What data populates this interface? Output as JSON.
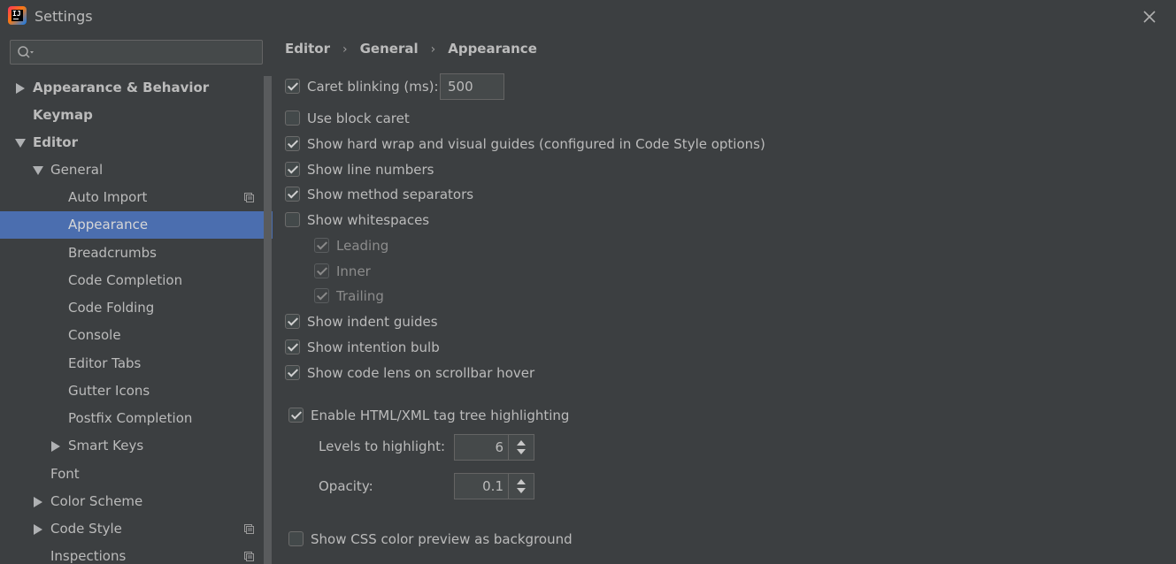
{
  "window": {
    "title": "Settings"
  },
  "search": {
    "placeholder": ""
  },
  "sidebar": {
    "items": [
      {
        "label": "Appearance & Behavior",
        "bold": true,
        "expand": "right"
      },
      {
        "label": "Keymap",
        "bold": true,
        "expand": "none"
      },
      {
        "label": "Editor",
        "bold": true,
        "expand": "down"
      },
      {
        "label": "General",
        "bold": false,
        "expand": "down"
      },
      {
        "label": "Auto Import",
        "bold": false,
        "expand": "none",
        "project_icon": true
      },
      {
        "label": "Appearance",
        "bold": false,
        "expand": "none",
        "selected": true
      },
      {
        "label": "Breadcrumbs",
        "bold": false,
        "expand": "none"
      },
      {
        "label": "Code Completion",
        "bold": false,
        "expand": "none"
      },
      {
        "label": "Code Folding",
        "bold": false,
        "expand": "none"
      },
      {
        "label": "Console",
        "bold": false,
        "expand": "none"
      },
      {
        "label": "Editor Tabs",
        "bold": false,
        "expand": "none"
      },
      {
        "label": "Gutter Icons",
        "bold": false,
        "expand": "none"
      },
      {
        "label": "Postfix Completion",
        "bold": false,
        "expand": "none"
      },
      {
        "label": "Smart Keys",
        "bold": false,
        "expand": "right"
      },
      {
        "label": "Font",
        "bold": false,
        "expand": "none"
      },
      {
        "label": "Color Scheme",
        "bold": false,
        "expand": "right"
      },
      {
        "label": "Code Style",
        "bold": false,
        "expand": "right",
        "project_icon": true
      },
      {
        "label": "Inspections",
        "bold": false,
        "expand": "none",
        "project_icon": true
      }
    ]
  },
  "breadcrumb": [
    "Editor",
    "General",
    "Appearance"
  ],
  "breadcrumb_separator": "›",
  "options": {
    "caret_blinking": {
      "label": "Caret blinking (ms):",
      "checked": true,
      "value": "500"
    },
    "block_caret": {
      "label": "Use block caret",
      "checked": false
    },
    "hard_wrap": {
      "label": "Show hard wrap and visual guides (configured in Code Style options)",
      "checked": true
    },
    "line_numbers": {
      "label": "Show line numbers",
      "checked": true
    },
    "method_separators": {
      "label": "Show method separators",
      "checked": true
    },
    "whitespaces": {
      "label": "Show whitespaces",
      "checked": false
    },
    "leading": {
      "label": "Leading",
      "checked": true,
      "disabled": true
    },
    "inner": {
      "label": "Inner",
      "checked": true,
      "disabled": true
    },
    "trailing": {
      "label": "Trailing",
      "checked": true,
      "disabled": true
    },
    "indent_guides": {
      "label": "Show indent guides",
      "checked": true
    },
    "intention_bulb": {
      "label": "Show intention bulb",
      "checked": true
    },
    "code_lens": {
      "label": "Show code lens on scrollbar hover",
      "checked": true
    },
    "tag_tree": {
      "label": "Enable HTML/XML tag tree highlighting",
      "checked": true
    },
    "levels": {
      "label": "Levels to highlight:",
      "value": "6"
    },
    "opacity": {
      "label": "Opacity:",
      "value": "0.1"
    },
    "css_preview": {
      "label": "Show CSS color preview as background",
      "checked": false
    }
  },
  "colors": {
    "background": "#3c3f41",
    "selection": "#4b6eaf",
    "text": "#bbbbbb"
  }
}
